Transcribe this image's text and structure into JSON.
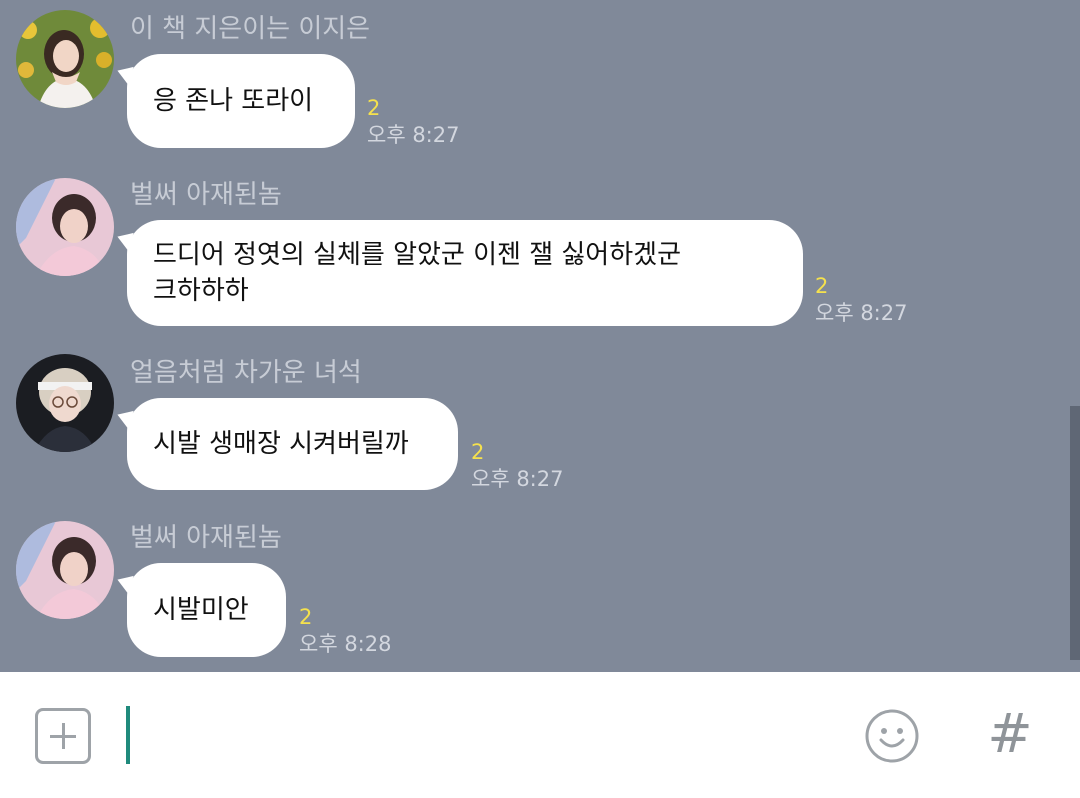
{
  "messages": [
    {
      "sender": "이 책 지은이는 이지은",
      "text": "응 존나 또라이",
      "unread": "2",
      "time": "오후 8:27",
      "avatar_icon": "girl-with-flowers-avatar"
    },
    {
      "sender": "벌써 아재된놈",
      "text": "드디어 정엿의 실체를 알았군 이젠 잴 싫어하겠군\n크하하하",
      "unread": "2",
      "time": "오후 8:27",
      "avatar_icon": "boy-pink-background-avatar"
    },
    {
      "sender": "얼음처럼 차가운 녀석",
      "text": "시발 생매장 시켜버릴까",
      "unread": "2",
      "time": "오후 8:27",
      "avatar_icon": "boy-with-glasses-avatar"
    },
    {
      "sender": "벌써 아재된놈",
      "text": "시발미안",
      "unread": "2",
      "time": "오후 8:28",
      "avatar_icon": "boy-pink-background-avatar"
    }
  ],
  "input_bar": {
    "add_icon": "plus-square-icon",
    "emoji_icon": "smiley-icon",
    "hash_icon": "hashtag-icon",
    "hash_glyph": "#",
    "message_value": ""
  },
  "colors": {
    "chat_background": "#808999",
    "bubble": "#ffffff",
    "unread_count": "#f5e14d",
    "cursor": "#1f8a7c"
  }
}
